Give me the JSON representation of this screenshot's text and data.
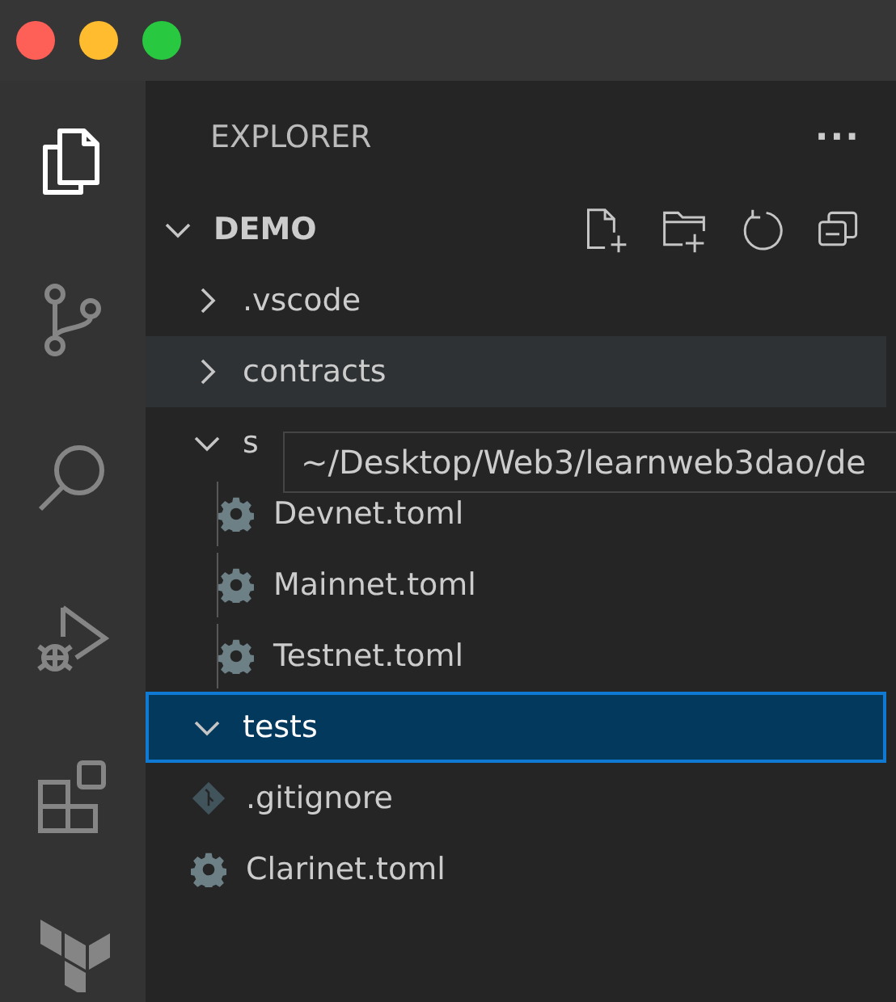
{
  "activity_bar": [
    {
      "kind": "files",
      "selected": true
    },
    {
      "kind": "source-control",
      "selected": false
    },
    {
      "kind": "search",
      "selected": false
    },
    {
      "kind": "run-debug",
      "selected": false
    },
    {
      "kind": "extensions",
      "selected": false
    },
    {
      "kind": "terraform",
      "selected": false
    }
  ],
  "sidebar": {
    "title": "EXPLORER",
    "more": "···",
    "root": {
      "label": "DEMO",
      "expanded": true,
      "children": [
        {
          "kind": "folder",
          "label": ".vscode",
          "expanded": false,
          "selected": false,
          "hovered": false
        },
        {
          "kind": "folder",
          "label": "contracts",
          "expanded": false,
          "selected": false,
          "hovered": true
        },
        {
          "kind": "folder",
          "label": "s",
          "expanded": true,
          "selected": false,
          "hovered": false,
          "children": [
            {
              "kind": "config",
              "label": "Devnet.toml",
              "selected": false,
              "hovered": false
            },
            {
              "kind": "config",
              "label": "Mainnet.toml",
              "selected": false,
              "hovered": false
            },
            {
              "kind": "config",
              "label": "Testnet.toml",
              "selected": false,
              "hovered": false
            }
          ]
        },
        {
          "kind": "folder",
          "label": "tests",
          "expanded": true,
          "selected": true,
          "hovered": false
        },
        {
          "kind": "git",
          "label": ".gitignore",
          "selected": false,
          "hovered": false
        },
        {
          "kind": "config",
          "label": "Clarinet.toml",
          "selected": false,
          "hovered": false
        }
      ]
    }
  },
  "tooltip": {
    "text": "~/Desktop/Web3/learnweb3dao/de"
  }
}
